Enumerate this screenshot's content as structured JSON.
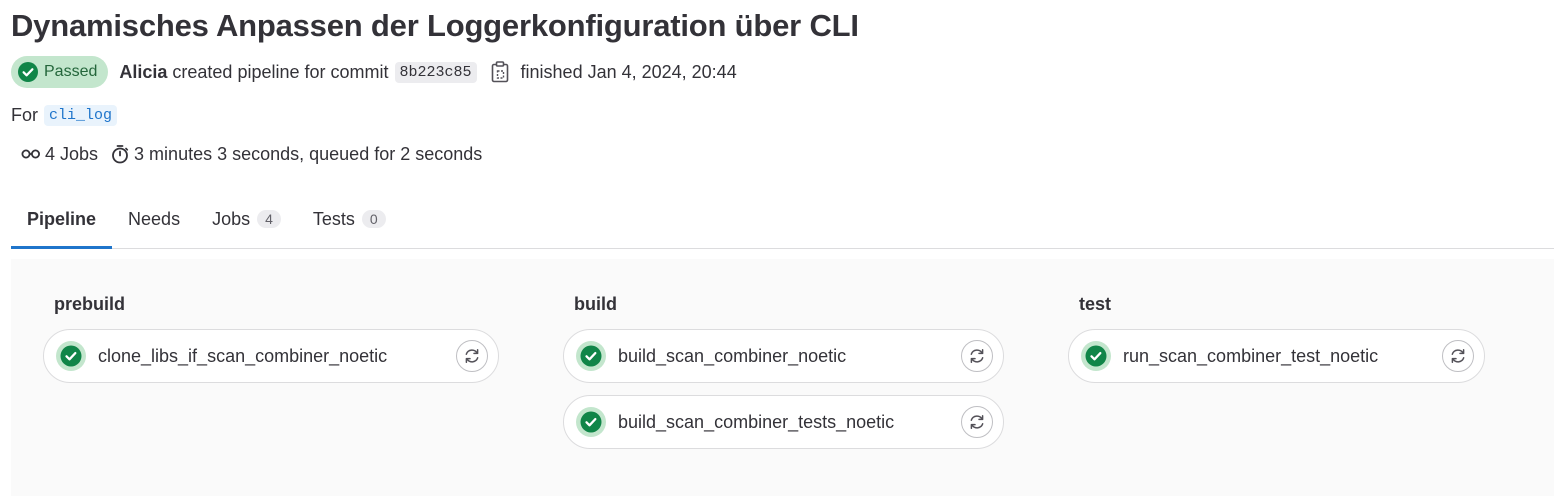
{
  "pipeline": {
    "title": "Dynamisches Anpassen der Loggerkonfiguration über CLI",
    "status_label": "Passed",
    "author": "Alicia",
    "created_text": "created pipeline for commit",
    "commit_sha": "8b223c85",
    "finished_text": "finished Jan 4, 2024, 20:44",
    "for_label": "For",
    "ref": "cli_log",
    "jobs_count_text": "4 Jobs",
    "duration_text": "3 minutes 3 seconds, queued for 2 seconds"
  },
  "tabs": [
    {
      "label": "Pipeline",
      "count": null,
      "active": true
    },
    {
      "label": "Needs",
      "count": null,
      "active": false
    },
    {
      "label": "Jobs",
      "count": "4",
      "active": false
    },
    {
      "label": "Tests",
      "count": "0",
      "active": false
    }
  ],
  "stages": [
    {
      "name": "prebuild",
      "jobs": [
        {
          "name": "clone_libs_if_scan_combiner_noetic",
          "status": "passed"
        }
      ]
    },
    {
      "name": "build",
      "jobs": [
        {
          "name": "build_scan_combiner_noetic",
          "status": "passed"
        },
        {
          "name": "build_scan_combiner_tests_noetic",
          "status": "passed"
        }
      ]
    },
    {
      "name": "test",
      "jobs": [
        {
          "name": "run_scan_combiner_test_noetic",
          "status": "passed"
        }
      ]
    }
  ],
  "icons": {
    "status": "check-circle-icon",
    "copy": "clipboard-icon",
    "jobs": "pipeline-icon",
    "duration": "timer-icon",
    "retry": "retry-icon"
  },
  "colors": {
    "success": "#108548",
    "success_bg": "#c3e6cd",
    "accent": "#1f75cb"
  }
}
